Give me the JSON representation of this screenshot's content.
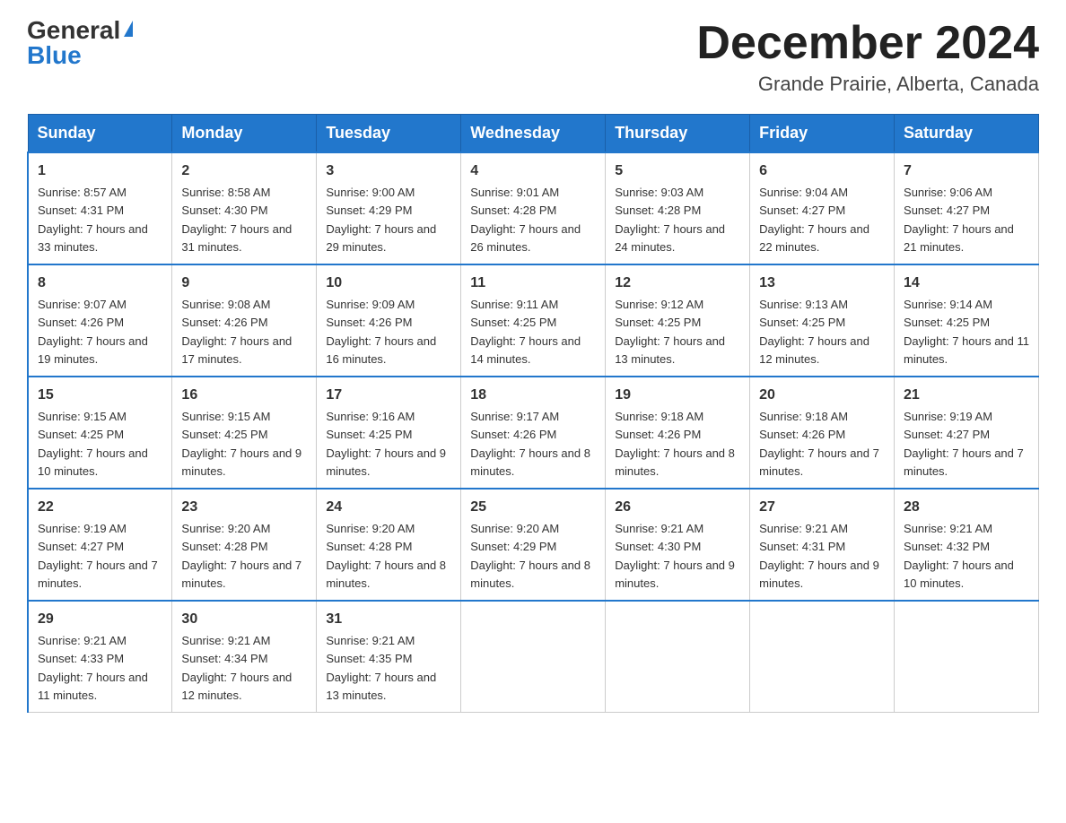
{
  "logo": {
    "general": "General",
    "blue": "Blue"
  },
  "title": "December 2024",
  "location": "Grande Prairie, Alberta, Canada",
  "headers": [
    "Sunday",
    "Monday",
    "Tuesday",
    "Wednesday",
    "Thursday",
    "Friday",
    "Saturday"
  ],
  "weeks": [
    [
      {
        "day": "1",
        "sunrise": "8:57 AM",
        "sunset": "4:31 PM",
        "daylight": "7 hours and 33 minutes."
      },
      {
        "day": "2",
        "sunrise": "8:58 AM",
        "sunset": "4:30 PM",
        "daylight": "7 hours and 31 minutes."
      },
      {
        "day": "3",
        "sunrise": "9:00 AM",
        "sunset": "4:29 PM",
        "daylight": "7 hours and 29 minutes."
      },
      {
        "day": "4",
        "sunrise": "9:01 AM",
        "sunset": "4:28 PM",
        "daylight": "7 hours and 26 minutes."
      },
      {
        "day": "5",
        "sunrise": "9:03 AM",
        "sunset": "4:28 PM",
        "daylight": "7 hours and 24 minutes."
      },
      {
        "day": "6",
        "sunrise": "9:04 AM",
        "sunset": "4:27 PM",
        "daylight": "7 hours and 22 minutes."
      },
      {
        "day": "7",
        "sunrise": "9:06 AM",
        "sunset": "4:27 PM",
        "daylight": "7 hours and 21 minutes."
      }
    ],
    [
      {
        "day": "8",
        "sunrise": "9:07 AM",
        "sunset": "4:26 PM",
        "daylight": "7 hours and 19 minutes."
      },
      {
        "day": "9",
        "sunrise": "9:08 AM",
        "sunset": "4:26 PM",
        "daylight": "7 hours and 17 minutes."
      },
      {
        "day": "10",
        "sunrise": "9:09 AM",
        "sunset": "4:26 PM",
        "daylight": "7 hours and 16 minutes."
      },
      {
        "day": "11",
        "sunrise": "9:11 AM",
        "sunset": "4:25 PM",
        "daylight": "7 hours and 14 minutes."
      },
      {
        "day": "12",
        "sunrise": "9:12 AM",
        "sunset": "4:25 PM",
        "daylight": "7 hours and 13 minutes."
      },
      {
        "day": "13",
        "sunrise": "9:13 AM",
        "sunset": "4:25 PM",
        "daylight": "7 hours and 12 minutes."
      },
      {
        "day": "14",
        "sunrise": "9:14 AM",
        "sunset": "4:25 PM",
        "daylight": "7 hours and 11 minutes."
      }
    ],
    [
      {
        "day": "15",
        "sunrise": "9:15 AM",
        "sunset": "4:25 PM",
        "daylight": "7 hours and 10 minutes."
      },
      {
        "day": "16",
        "sunrise": "9:15 AM",
        "sunset": "4:25 PM",
        "daylight": "7 hours and 9 minutes."
      },
      {
        "day": "17",
        "sunrise": "9:16 AM",
        "sunset": "4:25 PM",
        "daylight": "7 hours and 9 minutes."
      },
      {
        "day": "18",
        "sunrise": "9:17 AM",
        "sunset": "4:26 PM",
        "daylight": "7 hours and 8 minutes."
      },
      {
        "day": "19",
        "sunrise": "9:18 AM",
        "sunset": "4:26 PM",
        "daylight": "7 hours and 8 minutes."
      },
      {
        "day": "20",
        "sunrise": "9:18 AM",
        "sunset": "4:26 PM",
        "daylight": "7 hours and 7 minutes."
      },
      {
        "day": "21",
        "sunrise": "9:19 AM",
        "sunset": "4:27 PM",
        "daylight": "7 hours and 7 minutes."
      }
    ],
    [
      {
        "day": "22",
        "sunrise": "9:19 AM",
        "sunset": "4:27 PM",
        "daylight": "7 hours and 7 minutes."
      },
      {
        "day": "23",
        "sunrise": "9:20 AM",
        "sunset": "4:28 PM",
        "daylight": "7 hours and 7 minutes."
      },
      {
        "day": "24",
        "sunrise": "9:20 AM",
        "sunset": "4:28 PM",
        "daylight": "7 hours and 8 minutes."
      },
      {
        "day": "25",
        "sunrise": "9:20 AM",
        "sunset": "4:29 PM",
        "daylight": "7 hours and 8 minutes."
      },
      {
        "day": "26",
        "sunrise": "9:21 AM",
        "sunset": "4:30 PM",
        "daylight": "7 hours and 9 minutes."
      },
      {
        "day": "27",
        "sunrise": "9:21 AM",
        "sunset": "4:31 PM",
        "daylight": "7 hours and 9 minutes."
      },
      {
        "day": "28",
        "sunrise": "9:21 AM",
        "sunset": "4:32 PM",
        "daylight": "7 hours and 10 minutes."
      }
    ],
    [
      {
        "day": "29",
        "sunrise": "9:21 AM",
        "sunset": "4:33 PM",
        "daylight": "7 hours and 11 minutes."
      },
      {
        "day": "30",
        "sunrise": "9:21 AM",
        "sunset": "4:34 PM",
        "daylight": "7 hours and 12 minutes."
      },
      {
        "day": "31",
        "sunrise": "9:21 AM",
        "sunset": "4:35 PM",
        "daylight": "7 hours and 13 minutes."
      },
      null,
      null,
      null,
      null
    ]
  ]
}
